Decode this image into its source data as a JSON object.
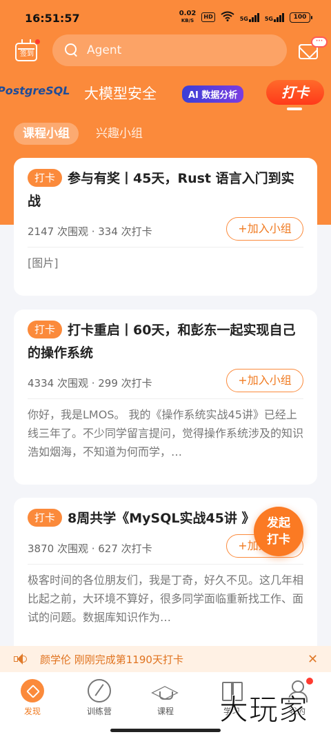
{
  "status_bar": {
    "time": "16:51:57",
    "net_speed": "0.02",
    "net_unit": "KB/S",
    "hd": "HD",
    "sig1": "5G",
    "sig2": "5G",
    "battery": "100"
  },
  "header": {
    "checkin_label": "签到",
    "search_placeholder": "Agent",
    "msg_badge": "···"
  },
  "categories": {
    "postgres": "PostgreSQL",
    "llm_security": "大模型安全",
    "ai_analysis": "AI 数据分析",
    "daka": "打卡"
  },
  "group_tabs": {
    "course_group": "课程小组",
    "interest_group": "兴趣小组"
  },
  "cards": [
    {
      "tag": "打卡",
      "title": "参与有奖丨45天，Rust 语言入门到实战",
      "stats": "2147 次围观 · 334 次打卡",
      "join": "+加入小组",
      "body": "[图片]"
    },
    {
      "tag": "打卡",
      "title": "打卡重启丨60天，和彭东一起实现自己的操作系统",
      "stats": "4334 次围观 · 299 次打卡",
      "join": "+加入小组",
      "body": "你好，我是LMOS。 我的《操作系统实战45讲》已经上线三年了。不少同学留言提问，觉得操作系统涉及的知识浩如烟海，不知道为何而学，…"
    },
    {
      "tag": "打卡",
      "title": "8周共学《MySQL实战45讲 》",
      "stats": "3870 次围观 · 627 次打卡",
      "join": "+加入小组",
      "body": "极客时间的各位朋友们，我是丁奇，好久不见。这几年相比起之前，大环境不算好，很多同学面临重新找工作、面试的问题。数据库知识作为…"
    }
  ],
  "fab": {
    "line1": "发起",
    "line2": "打卡"
  },
  "notification": {
    "text": "颜学伦 刚刚完成第1190天打卡",
    "close": "✕"
  },
  "bottom_nav": [
    {
      "label": "发现",
      "icon": "discover-icon"
    },
    {
      "label": "训练营",
      "icon": "camp-icon"
    },
    {
      "label": "课程",
      "icon": "course-icon"
    },
    {
      "label": "学习",
      "icon": "study-icon"
    },
    {
      "label": "我的",
      "icon": "me-icon"
    }
  ],
  "watermark": "大玩家",
  "colors": {
    "accent": "#fb8a3b",
    "text": "#222222",
    "muted": "#777777"
  }
}
